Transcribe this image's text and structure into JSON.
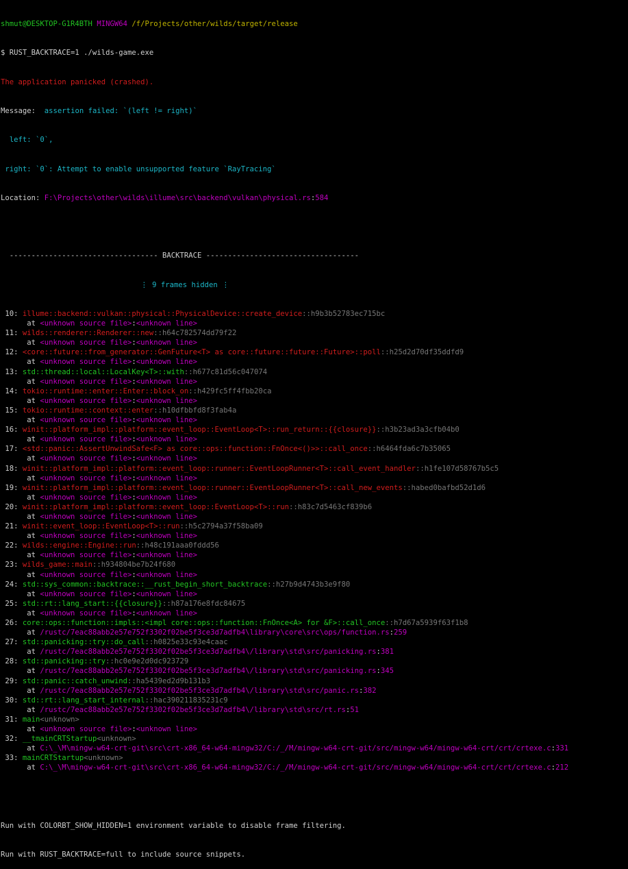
{
  "prompt": {
    "user_host": "shmut@DESKTOP-G1R4BTH",
    "shell": "MINGW64",
    "cwd": "/f/Projects/other/wilds/target/release",
    "command": "$ RUST_BACKTRACE=1 ./wilds-game.exe"
  },
  "panic": {
    "header": "The application panicked (crashed).",
    "message_label": "Message:",
    "message_text": "assertion failed: `(left != right)`",
    "left_line": "  left: `0`,",
    "right_line": " right: `0`: Attempt to enable unsupported feature `RayTracing`",
    "location_label": "Location:",
    "location_path": "F:\\Projects\\other\\wilds\\illume\\src\\backend\\vulkan\\physical.rs",
    "location_line": "584"
  },
  "backtrace_header": "  ---------------------------------- BACKTRACE -----------------------------------",
  "hidden_line": {
    "prefix": "                                ",
    "text": "⋮ 9 frames hidden ⋮"
  },
  "frames": [
    {
      "num": " 10:",
      "fn": "illume::backend::vulkan::physical::PhysicalDevice::create_device",
      "hash": "::h9b3b52783ec715bc",
      "color": "red",
      "loc": "<unknown source file>",
      "lineno": "<unknown line>"
    },
    {
      "num": " 11:",
      "fn": "wilds::renderer::Renderer::new",
      "hash": "::h64c782574dd79f22",
      "color": "red",
      "loc": "<unknown source file>",
      "lineno": "<unknown line>"
    },
    {
      "num": " 12:",
      "fn": "<core::future::from_generator::GenFuture<T> as core::future::future::Future>::poll",
      "hash": "::h25d2d70df35ddfd9",
      "color": "red",
      "loc": "<unknown source file>",
      "lineno": "<unknown line>"
    },
    {
      "num": " 13:",
      "fn": "std::thread::local::LocalKey<T>::with",
      "hash": "::h677c81d56c047074",
      "color": "green",
      "loc": "<unknown source file>",
      "lineno": "<unknown line>"
    },
    {
      "num": " 14:",
      "fn": "tokio::runtime::enter::Enter::block_on",
      "hash": "::h429fc5ff4fbb20ca",
      "color": "red",
      "loc": "<unknown source file>",
      "lineno": "<unknown line>"
    },
    {
      "num": " 15:",
      "fn": "tokio::runtime::context::enter",
      "hash": "::h10dfbbfd8f3fab4a",
      "color": "red",
      "loc": "<unknown source file>",
      "lineno": "<unknown line>"
    },
    {
      "num": " 16:",
      "fn": "winit::platform_impl::platform::event_loop::EventLoop<T>::run_return::{{closure}}",
      "hash": "::h3b23ad3a3cfb04b0",
      "color": "red",
      "loc": "<unknown source file>",
      "lineno": "<unknown line>"
    },
    {
      "num": " 17:",
      "fn": "<std::panic::AssertUnwindSafe<F> as core::ops::function::FnOnce<()>>::call_once",
      "hash": "::h6464fda6c7b35065",
      "color": "red",
      "loc": "<unknown source file>",
      "lineno": "<unknown line>"
    },
    {
      "num": " 18:",
      "fn": "winit::platform_impl::platform::event_loop::runner::EventLoopRunner<T>::call_event_handler",
      "hash": "::h1fe107d58767b5c5",
      "color": "red",
      "loc": "<unknown source file>",
      "lineno": "<unknown line>"
    },
    {
      "num": " 19:",
      "fn": "winit::platform_impl::platform::event_loop::runner::EventLoopRunner<T>::call_new_events",
      "hash": "::habed0bafbd52d1d6",
      "color": "red",
      "loc": "<unknown source file>",
      "lineno": "<unknown line>"
    },
    {
      "num": " 20:",
      "fn": "winit::platform_impl::platform::event_loop::EventLoop<T>::run",
      "hash": "::h83c7d5463cf839b6",
      "color": "red",
      "loc": "<unknown source file>",
      "lineno": "<unknown line>"
    },
    {
      "num": " 21:",
      "fn": "winit::event_loop::EventLoop<T>::run",
      "hash": "::h5c2794a37f58ba09",
      "color": "red",
      "loc": "<unknown source file>",
      "lineno": "<unknown line>"
    },
    {
      "num": " 22:",
      "fn": "wilds::engine::Engine::run",
      "hash": "::h48c191aaa0fddd56",
      "color": "red",
      "loc": "<unknown source file>",
      "lineno": "<unknown line>"
    },
    {
      "num": " 23:",
      "fn": "wilds_game::main",
      "hash": "::h934804be7b24f680",
      "color": "red",
      "loc": "<unknown source file>",
      "lineno": "<unknown line>"
    },
    {
      "num": " 24:",
      "fn": "std::sys_common::backtrace::__rust_begin_short_backtrace",
      "hash": "::h27b9d4743b3e9f80",
      "color": "green",
      "loc": "<unknown source file>",
      "lineno": "<unknown line>"
    },
    {
      "num": " 25:",
      "fn": "std::rt::lang_start::{{closure}}",
      "hash": "::h87a176e8fdc84675",
      "color": "green",
      "loc": "<unknown source file>",
      "lineno": "<unknown line>"
    },
    {
      "num": " 26:",
      "fn": "core::ops::function::impls::<impl core::ops::function::FnOnce<A> for &F>::call_once",
      "hash": "::h7d67a5939f63f1b8",
      "color": "green",
      "loc": "/rustc/7eac88abb2e57e752f3302f02be5f3ce3d7adfb4\\library\\core\\src\\ops/function.rs",
      "lineno": "259"
    },
    {
      "num": " 27:",
      "fn": "std::panicking::try::do_call",
      "hash": "::h0825e33c93e4caac",
      "color": "green",
      "loc": "/rustc/7eac88abb2e57e752f3302f02be5f3ce3d7adfb4\\/library\\std\\src/panicking.rs",
      "lineno": "381"
    },
    {
      "num": " 28:",
      "fn": "std::panicking::try",
      "hash": "::hc0e9e2d0dc923729",
      "color": "green",
      "loc": "/rustc/7eac88abb2e57e752f3302f02be5f3ce3d7adfb4\\/library\\std\\src/panicking.rs",
      "lineno": "345"
    },
    {
      "num": " 29:",
      "fn": "std::panic::catch_unwind",
      "hash": "::ha5439ed2d9b131b3",
      "color": "green",
      "loc": "/rustc/7eac88abb2e57e752f3302f02be5f3ce3d7adfb4\\/library\\std\\src/panic.rs",
      "lineno": "382"
    },
    {
      "num": " 30:",
      "fn": "std::rt::lang_start_internal",
      "hash": "::hac390211835231c9",
      "color": "green",
      "loc": "/rustc/7eac88abb2e57e752f3302f02be5f3ce3d7adfb4\\/library\\std\\src/rt.rs",
      "lineno": "51"
    },
    {
      "num": " 31:",
      "fn": "main",
      "hash": "<unknown>",
      "color": "green",
      "loc": "<unknown source file>",
      "lineno": "<unknown line>"
    },
    {
      "num": " 32:",
      "fn": "__tmainCRTStartup",
      "hash": "<unknown>",
      "color": "green",
      "loc": "C:\\_\\M\\mingw-w64-crt-git\\src\\crt-x86_64-w64-mingw32/C:/_/M/mingw-w64-crt-git/src/mingw-w64/mingw-w64-crt/crt/crtexe.c",
      "lineno": "331"
    },
    {
      "num": " 33:",
      "fn": "mainCRTStartup",
      "hash": "<unknown>",
      "color": "green",
      "loc": "C:\\_\\M\\mingw-w64-crt-git\\src\\crt-x86_64-w64-mingw32/C:/_/M/mingw-w64-crt-git/src/mingw-w64/mingw-w64-crt/crt/crtexe.c",
      "lineno": "212"
    }
  ],
  "at_prefix": "      at ",
  "footer": [
    "Run with COLORBT_SHOW_HIDDEN=1 environment variable to disable frame filtering.",
    "Run with RUST_BACKTRACE=full to include source snippets."
  ],
  "colors": {
    "background": "#000000",
    "text": "#c0c0c0",
    "green": "#22c322",
    "yellow": "#c0b400",
    "purple": "#c000c0",
    "red": "#d21d1d",
    "cyan": "#1cb5c6",
    "gray": "#777777"
  }
}
